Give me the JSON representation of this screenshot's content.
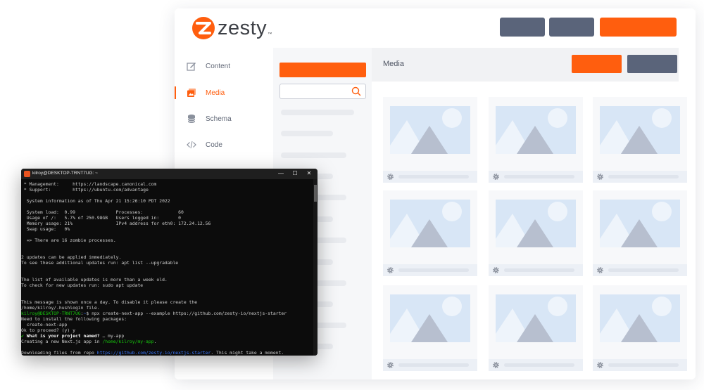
{
  "app": {
    "brand": {
      "name": "zesty",
      "trademark": "™",
      "colors": {
        "accent": "#ff5e0e",
        "secondary": "#5a647a"
      }
    },
    "nav": [
      {
        "label": "Content",
        "icon": "edit-icon",
        "active": false
      },
      {
        "label": "Media",
        "icon": "media-icon",
        "active": true
      },
      {
        "label": "Schema",
        "icon": "database-icon",
        "active": false
      },
      {
        "label": "Code",
        "icon": "code-icon",
        "active": false
      }
    ],
    "main": {
      "title": "Media"
    }
  },
  "terminal": {
    "title": "kilroy@DESKTOP-TRNT7UG: ~",
    "controls": {
      "minimize": "—",
      "maximize": "☐",
      "close": "✕"
    },
    "lines": [
      [
        {
          "t": " * Management:     https://landscape.canonical.com"
        }
      ],
      [
        {
          "t": " * Support:        https://ubuntu.com/advantage"
        }
      ],
      [
        {
          "t": ""
        }
      ],
      [
        {
          "t": "  System information as of Thu Apr 21 15:26:10 PDT 2022"
        }
      ],
      [
        {
          "t": ""
        }
      ],
      [
        {
          "t": "  System load:  0.99               Processes:             60"
        }
      ],
      [
        {
          "t": "  Usage of /:   5.7% of 250.98GB   Users logged in:       0"
        }
      ],
      [
        {
          "t": "  Memory usage: 21%                IPv4 address for eth0: 172.24.12.56"
        }
      ],
      [
        {
          "t": "  Swap usage:   0%"
        }
      ],
      [
        {
          "t": ""
        }
      ],
      [
        {
          "t": "  => There are 16 zombie processes."
        }
      ],
      [
        {
          "t": ""
        }
      ],
      [
        {
          "t": ""
        }
      ],
      [
        {
          "t": "2 updates can be applied immediately."
        }
      ],
      [
        {
          "t": "To see these additional updates run: apt list --upgradable"
        }
      ],
      [
        {
          "t": ""
        }
      ],
      [
        {
          "t": ""
        }
      ],
      [
        {
          "t": "The list of available updates is more than a week old."
        }
      ],
      [
        {
          "t": "To check for new updates run: sudo apt update"
        }
      ],
      [
        {
          "t": ""
        }
      ],
      [
        {
          "t": ""
        }
      ],
      [
        {
          "t": "This message is shown once a day. To disable it please create the"
        }
      ],
      [
        {
          "t": "/home/kilroy/.hushlogin file."
        }
      ],
      [
        {
          "t": "kilroy@DESKTOP-TRNT7UG",
          "c": "g"
        },
        {
          "t": ":"
        },
        {
          "t": "~",
          "c": "b"
        },
        {
          "t": "$ npx create-next-app --example https://github.com/zesty-io/nextjs-starter"
        }
      ],
      [
        {
          "t": "Need to install the following packages:"
        }
      ],
      [
        {
          "t": "  create-next-app"
        }
      ],
      [
        {
          "t": "Ok to proceed? (y) y"
        }
      ],
      [
        {
          "t": "✔ ",
          "c": "g"
        },
        {
          "t": "What is your project named?",
          "c": "w"
        },
        {
          "t": " … my-app"
        }
      ],
      [
        {
          "t": "Creating a new Next.js app in "
        },
        {
          "t": "/home/kilroy/my-app",
          "c": "g"
        },
        {
          "t": "."
        }
      ],
      [
        {
          "t": ""
        }
      ],
      [
        {
          "t": "Downloading files from repo "
        },
        {
          "t": "https://github.com/zesty-io/nextjs-starter",
          "c": "b"
        },
        {
          "t": ". This might take a moment."
        }
      ]
    ]
  }
}
